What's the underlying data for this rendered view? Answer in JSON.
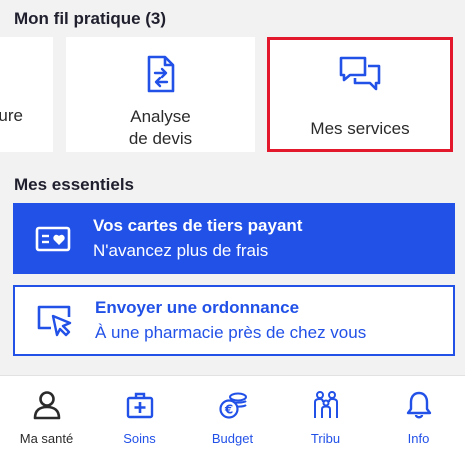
{
  "fil_pratique": {
    "title": "Mon fil pratique (3)",
    "cards": [
      {
        "label": "ure",
        "icon": "document-icon"
      },
      {
        "label_line1": "Analyse",
        "label_line2": "de devis",
        "icon": "document-exchange-icon"
      },
      {
        "label": "Mes services",
        "icon": "chat-bubbles-icon"
      }
    ]
  },
  "essentiels": {
    "title": "Mes essentiels",
    "banners": [
      {
        "title": "Vos cartes de tiers payant",
        "subtitle": "N'avancez plus de frais",
        "icon": "card-heart-icon"
      },
      {
        "title": "Envoyer une ordonnance",
        "subtitle": "À une pharmacie près de chez vous",
        "icon": "screen-cursor-icon"
      }
    ]
  },
  "nav": {
    "items": [
      {
        "label": "Ma santé",
        "icon": "person-icon",
        "active": true
      },
      {
        "label": "Soins",
        "icon": "medical-kit-icon"
      },
      {
        "label": "Budget",
        "icon": "euro-coins-icon"
      },
      {
        "label": "Tribu",
        "icon": "family-icon"
      },
      {
        "label": "Info",
        "icon": "bell-icon"
      }
    ]
  },
  "colors": {
    "primary": "#2251e8",
    "highlight": "#e3182d",
    "background": "#f2f2f2",
    "text": "#1f1f2e"
  }
}
